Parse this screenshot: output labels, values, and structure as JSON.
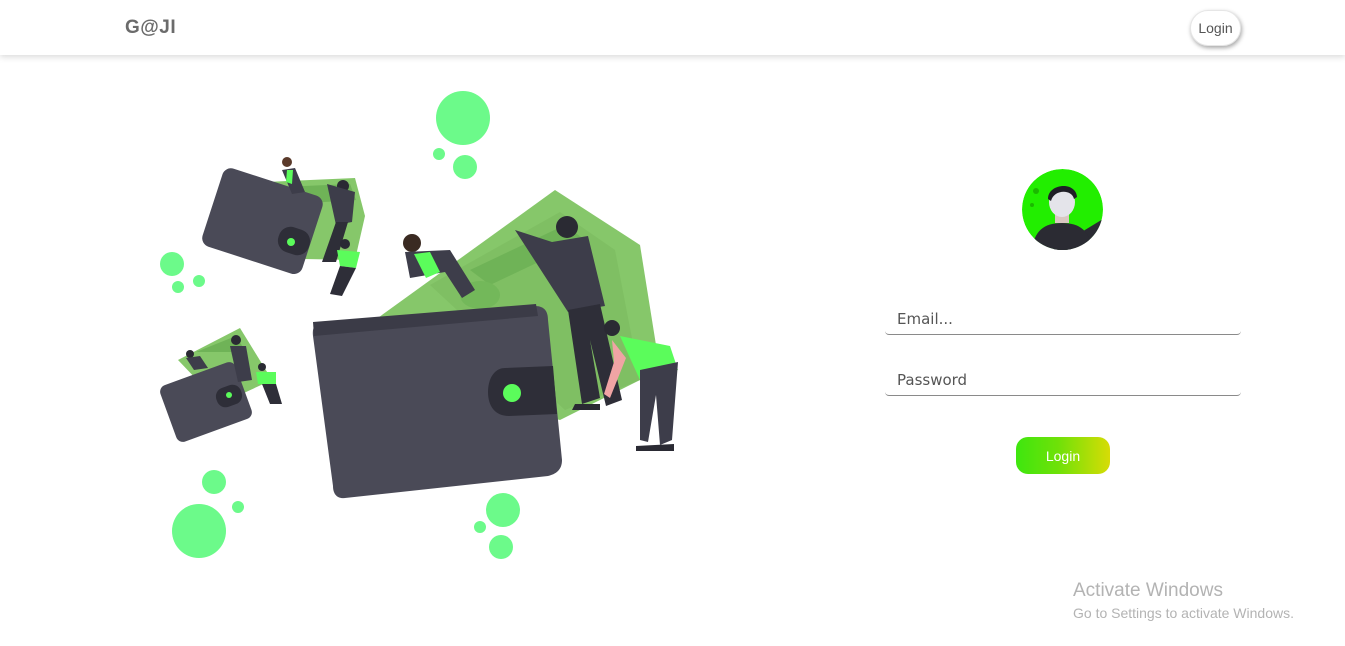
{
  "navbar": {
    "brand": "G@JI",
    "login_label": "Login"
  },
  "illustration": {
    "icon": "wallet-money-people-illustration",
    "colors": {
      "accent": "#6cfa8a",
      "money": "#86c76a",
      "wallet": "#4a4a57",
      "bright": "#5bfc5b"
    }
  },
  "login_form": {
    "avatar_icon": "user-avatar-icon",
    "email_placeholder": "Email...",
    "password_placeholder": "Password",
    "submit_label": "Login"
  },
  "watermark": {
    "title": "Activate Windows",
    "subtitle": "Go to Settings to activate Windows."
  },
  "colors": {
    "button_gradient_start": "#3ee60f",
    "button_gradient_end": "#d7dc06",
    "avatar_bg": "#22ee00"
  }
}
